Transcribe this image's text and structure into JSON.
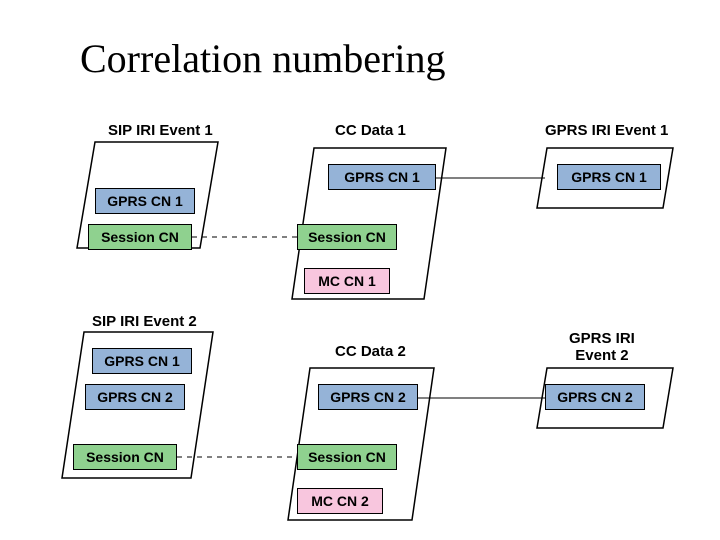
{
  "title": "Correlation numbering",
  "labels": {
    "sip1": "SIP IRI Event 1",
    "cc1": "CC Data 1",
    "gprs1": "GPRS IRI Event 1",
    "sip2": "SIP IRI Event 2",
    "cc2": "CC Data 2",
    "gprs2": "GPRS IRI\nEvent 2"
  },
  "boxes": {
    "gprs_cn1": "GPRS CN 1",
    "gprs_cn2": "GPRS CN 2",
    "session_cn": "Session CN",
    "mc_cn1": "MC CN 1",
    "mc_cn2": "MC CN 2"
  }
}
